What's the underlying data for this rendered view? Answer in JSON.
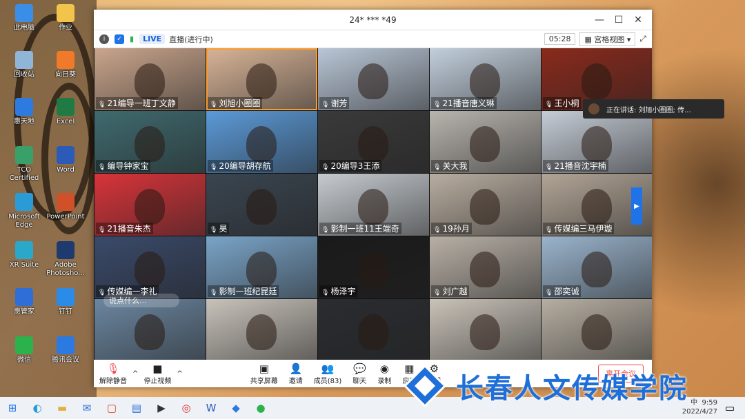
{
  "desktop": {
    "icons": [
      {
        "label": "此电脑",
        "color": "#3b8ee8"
      },
      {
        "label": "作业",
        "color": "#f2c44b"
      },
      {
        "label": "回收站",
        "color": "#8fb6d9"
      },
      {
        "label": "向日葵",
        "color": "#f07a2a"
      },
      {
        "label": "惠天地",
        "color": "#2d7be0"
      },
      {
        "label": "Excel",
        "color": "#1f7a44"
      },
      {
        "label": "TCO Certified",
        "color": "#3aa06a"
      },
      {
        "label": "Word",
        "color": "#2b5bb7"
      },
      {
        "label": "Microsoft Edge",
        "color": "#2a9bd6"
      },
      {
        "label": "PowerPoint",
        "color": "#d0502a"
      },
      {
        "label": "XR Suite",
        "color": "#2aa8c9"
      },
      {
        "label": "Adobe Photosho...",
        "color": "#1e3a6e"
      },
      {
        "label": "惠管家",
        "color": "#2d6fd6"
      },
      {
        "label": "钉钉",
        "color": "#2d8be8"
      },
      {
        "label": "微信",
        "color": "#2bb24c"
      },
      {
        "label": "腾讯会议",
        "color": "#2a7ae2"
      }
    ]
  },
  "window": {
    "title": "24* *** *49",
    "live_label": "LIVE",
    "live_status": "直播(进行中)",
    "timer": "05:28",
    "view_mode": "宫格视图"
  },
  "participants": [
    {
      "name": "21编导一班丁文静",
      "bg": "#caa58c"
    },
    {
      "name": "刘旭小圈圈",
      "bg": "#d8b497",
      "speaking": true
    },
    {
      "name": "谢芳",
      "bg": "#b9c6d6"
    },
    {
      "name": "21播音唐义琳",
      "bg": "#c2cfdc"
    },
    {
      "name": "王小桐",
      "bg": "#8a2a1c"
    },
    {
      "name": "编导钟家宝",
      "bg": "#3f6a6f"
    },
    {
      "name": "20编导胡存航",
      "bg": "#5b9ad8"
    },
    {
      "name": "20编导3王添",
      "bg": "#3a3a3a"
    },
    {
      "name": "关大我",
      "bg": "#b8b4ae"
    },
    {
      "name": "21播音沈宇楠",
      "bg": "#c5ccd6"
    },
    {
      "name": "21播音朱杰",
      "bg": "#d8343a"
    },
    {
      "name": "昊",
      "bg": "#3a4550"
    },
    {
      "name": "影制一班11王端奇",
      "bg": "#c6cbd0"
    },
    {
      "name": "19孙月",
      "bg": "#b8ada0"
    },
    {
      "name": "传媒编三马伊璇",
      "bg": "#b2a596"
    },
    {
      "name": "传媒编一李礼",
      "bg": "#3a4a6a"
    },
    {
      "name": "影制一班纪昆廷",
      "bg": "#7aa4c8"
    },
    {
      "name": "杨泽宇",
      "bg": "#1a1a1a"
    },
    {
      "name": "刘广越",
      "bg": "#b8b0a6"
    },
    {
      "name": "邵奕诚",
      "bg": "#9ab4cc"
    },
    {
      "name": "",
      "bg": "#6b86a0"
    },
    {
      "name": "",
      "bg": "#c8c2ba"
    },
    {
      "name": "",
      "bg": "#2a2c30"
    },
    {
      "name": "",
      "bg": "#c9c2b8"
    },
    {
      "name": "",
      "bg": "#b6aea2"
    }
  ],
  "speaker_popup": "正在讲话: 刘旭小圈圈; 传...",
  "chat_placeholder": "说点什么...",
  "toolbar": {
    "mute": "解除静音",
    "stop_video": "停止视频",
    "share": "共享屏幕",
    "invite": "邀请",
    "members": "成员(83)",
    "chat": "聊天",
    "record": "录制",
    "apps": "应用",
    "settings": "设置",
    "leave": "离开会议"
  },
  "taskbar": {
    "time": "9:59",
    "date": "2022/4/27",
    "ime": "中"
  },
  "watermark": "长春人文传媒学院"
}
